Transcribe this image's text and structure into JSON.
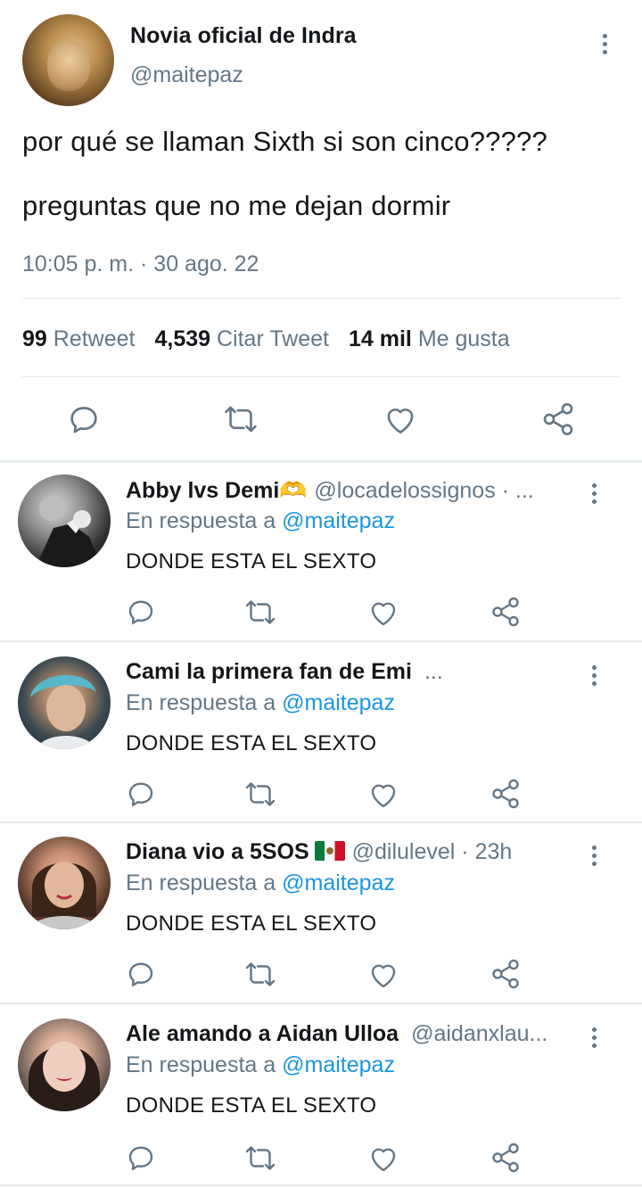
{
  "main": {
    "name": "Novia oficial de Indra",
    "handle": "@maitepaz",
    "line1": "por qué se llaman Sixth si son cinco?????",
    "line2": "preguntas que no me dejan dormir",
    "timestamp": "10:05 p. m. · 30 ago. 22",
    "stats": {
      "retweets": "99",
      "retweets_label": "Retweet",
      "quotes": "4,539",
      "quotes_label": "Citar Tweet",
      "likes": "14 mil",
      "likes_label": "Me gusta"
    },
    "actions": [
      "reply-icon",
      "retweet-icon",
      "like-icon",
      "share-icon"
    ]
  },
  "replies": [
    {
      "name": "Abby lvs Demi",
      "emoji": "🫶",
      "handle": "@locadelossignos · ...",
      "in_reply_prefix": "En respuesta a",
      "mention": "@maitepaz",
      "text": "DONDE ESTA EL SEXTO"
    },
    {
      "name": "Cami la primera fan de Emi",
      "handle": "...",
      "in_reply_prefix": "En respuesta a",
      "mention": "@maitepaz",
      "text": "DONDE ESTA EL SEXTO"
    },
    {
      "name": "Diana vio a 5SOS",
      "flag": "mexico-flag",
      "handle": "@dilulevel · 23h",
      "in_reply_prefix": "En respuesta a",
      "mention": "@maitepaz",
      "text": "DONDE ESTA EL SEXTO"
    },
    {
      "name": "Ale amando a Aidan Ulloa",
      "handle": "@aidanxlau...",
      "in_reply_prefix": "En respuesta a",
      "mention": "@maitepaz",
      "text": "DONDE ESTA EL SEXTO"
    }
  ],
  "colors": {
    "text": "#14171a",
    "secondary": "#657786",
    "link": "#1b95e0",
    "divider": "#e1e8ed"
  }
}
